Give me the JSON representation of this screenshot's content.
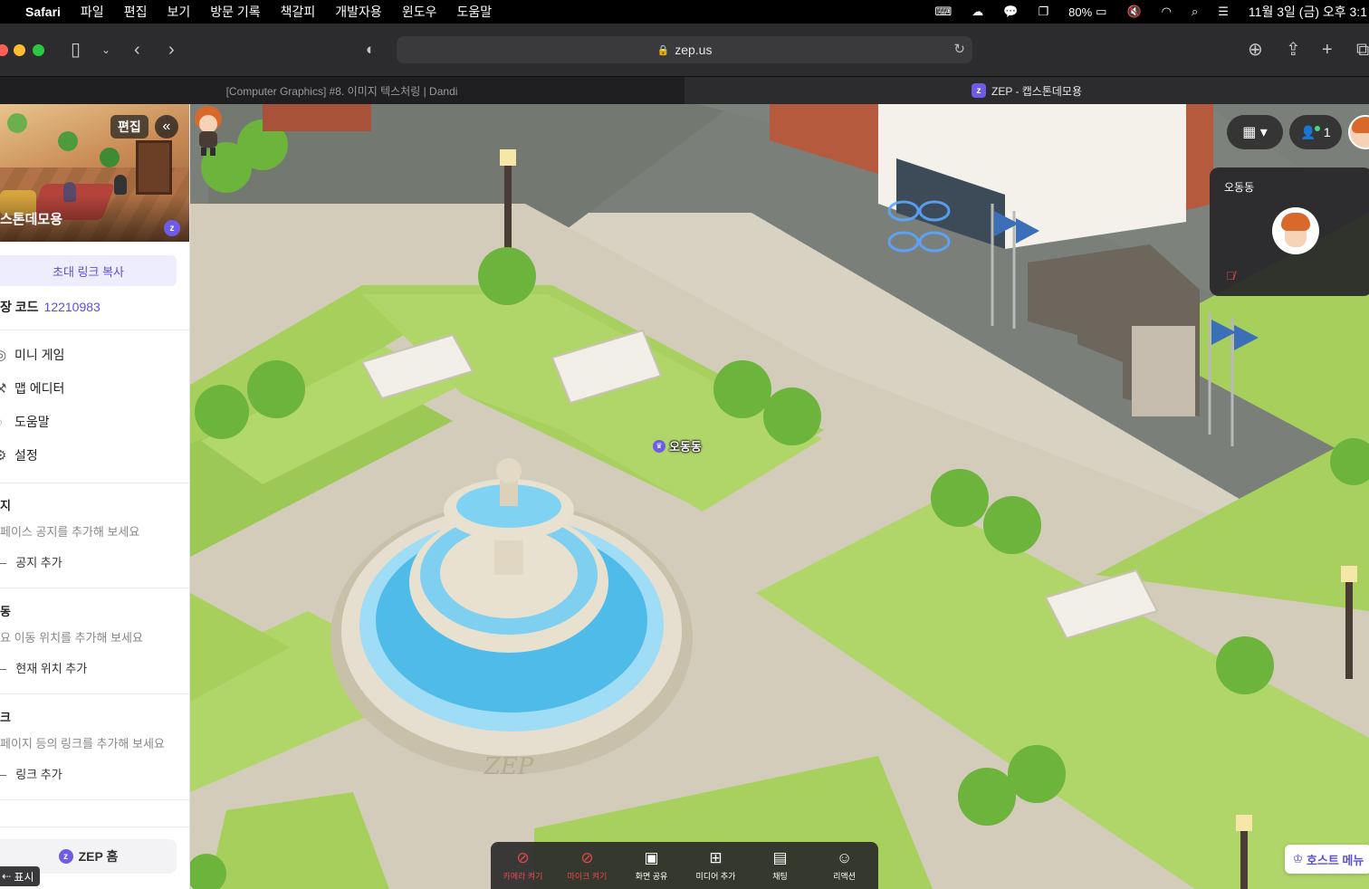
{
  "menubar": {
    "apple": "",
    "app": "Safari",
    "items": [
      "파일",
      "편집",
      "보기",
      "방문 기록",
      "책갈피",
      "개발자용",
      "윈도우",
      "도움말"
    ],
    "battery": "80%",
    "clock": "11월 3일 (금) 오후 3:1"
  },
  "browser": {
    "url": "zep.us",
    "tabs": [
      {
        "title": "[Computer Graphics] #8. 이미지 텍스처링 | Dandi",
        "active": false
      },
      {
        "title": "ZEP - 캡스톤데모용",
        "active": true
      }
    ],
    "colors": {
      "close": "#ff5f57",
      "minimize": "#febc2e",
      "zoom": "#28c840"
    }
  },
  "sidebar": {
    "edit_label": "편집",
    "space_name": "스톤데모용",
    "invite_label": "초대 링크 복사",
    "code_label": "장 코드",
    "code_value": "12210983",
    "menu": [
      {
        "label": "미니 게임",
        "icon": "gamepad-icon"
      },
      {
        "label": "맵 에디터",
        "icon": "hammer-icon"
      },
      {
        "label": "도움말",
        "icon": "help-icon"
      },
      {
        "label": "설정",
        "icon": "gear-icon"
      }
    ],
    "notice": {
      "title": "지",
      "desc": "페이스 공지를 추가해 보세요",
      "add": "공지 추가"
    },
    "move": {
      "title": "동",
      "desc": "요 이동 위치를 추가해 보세요",
      "add": "현재 위치 추가"
    },
    "link": {
      "title": "크",
      "desc": "페이지 등의 링크를 추가해 보세요",
      "add": "링크 추가"
    },
    "home_label": "ZEP 홈",
    "show_label": "표시"
  },
  "game": {
    "user_count": "1",
    "video_card_name": "오동동",
    "player_name": "오동동",
    "fountain_text": "ZEP",
    "bottom_bar": [
      {
        "label": "카메라 켜기",
        "icon": "camera-off-icon",
        "off": true
      },
      {
        "label": "마이크 켜기",
        "icon": "mic-off-icon",
        "off": true
      },
      {
        "label": "화면 공유",
        "icon": "screen-share-icon",
        "off": false
      },
      {
        "label": "미디어 추가",
        "icon": "media-add-icon",
        "off": false
      },
      {
        "label": "채팅",
        "icon": "chat-icon",
        "off": false
      },
      {
        "label": "리액션",
        "icon": "reaction-icon",
        "off": false
      }
    ],
    "host_menu_label": "호스트 메뉴",
    "accent": "#6c5ce7"
  }
}
